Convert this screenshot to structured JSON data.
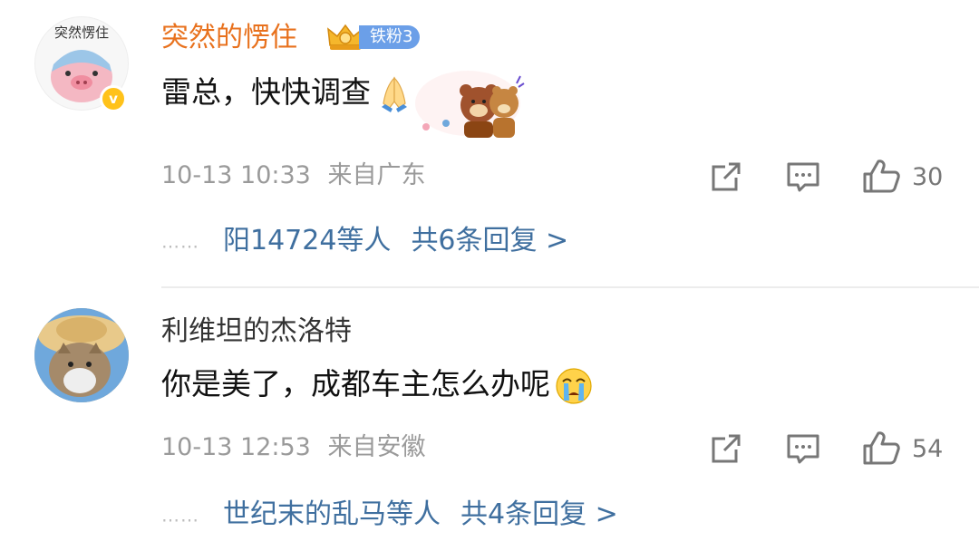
{
  "comments": [
    {
      "username": "突然的愣住",
      "fan_badge": "铁粉3",
      "text": "雷总，快快调查",
      "emoji": "pray-emoji",
      "has_sticker": true,
      "verified": true,
      "avatar_text": "突然愣住",
      "time": "10-13 10:33",
      "location": "来自广东",
      "likes": "30",
      "reply_dots": "……",
      "reply_users": "阳14724等人",
      "reply_total": "共6条回复 >"
    },
    {
      "username": "利维坦的杰洛特",
      "text": "你是美了，成都车主怎么办呢",
      "emoji": "crying-emoji",
      "time": "10-13 12:53",
      "location": "来自安徽",
      "likes": "54",
      "reply_dots": "……",
      "reply_users": "世纪末的乱马等人",
      "reply_total": "共4条回复 >"
    }
  ],
  "colors": {
    "username_highlight": "#e8711d",
    "link": "#3f6f9f",
    "meta": "#9a9a9a",
    "fan_badge": "#6b9fe8"
  }
}
